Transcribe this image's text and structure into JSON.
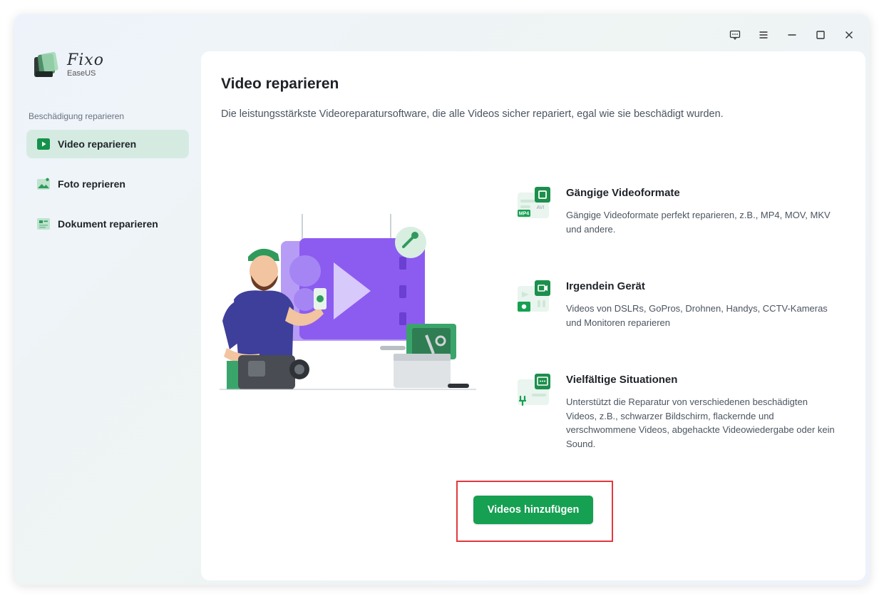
{
  "app": {
    "name": "Fixo",
    "vendor": "EaseUS"
  },
  "window_controls": {
    "feedback_icon": "message-icon",
    "menu_icon": "hamburger-menu-icon",
    "minimize_icon": "minimize-icon",
    "maximize_icon": "maximize-icon",
    "close_icon": "close-icon"
  },
  "sidebar": {
    "section_label": "Beschädigung reparieren",
    "items": [
      {
        "label": "Video reparieren",
        "icon": "video-play-icon",
        "active": true
      },
      {
        "label": "Foto reprieren",
        "icon": "photo-icon",
        "active": false
      },
      {
        "label": "Dokument reparieren",
        "icon": "document-icon",
        "active": false
      }
    ]
  },
  "main": {
    "title": "Video reparieren",
    "subtitle": "Die leistungsstärkste Videoreparatursoftware, die alle Videos sicher repariert, egal wie sie beschädigt wurden.",
    "features": [
      {
        "title": "Gängige Videoformate",
        "description": "Gängige Videoformate perfekt reparieren, z.B., MP4, MOV, MKV und andere.",
        "icon": "video-format-icon",
        "icon_tags": [
          "MP4",
          "AVI"
        ]
      },
      {
        "title": "Irgendein Gerät",
        "description": "Videos von DSLRs, GoPros, Drohnen, Handys, CCTV-Kameras und Monitoren reparieren",
        "icon": "device-camera-icon"
      },
      {
        "title": "Vielfältige Situationen",
        "description": "Unterstützt die Reparatur von verschiedenen beschädigten Videos, z.B., schwarzer Bildschirm, flackernde und verschwommene Videos, abgehackte Videowiedergabe oder kein Sound.",
        "icon": "situation-screen-icon"
      }
    ],
    "primary_button": "Videos hinzufügen"
  },
  "colors": {
    "accent_green": "#16a052",
    "active_nav_bg": "#d5ebe2",
    "highlight_red": "#e2393f",
    "illustration_purple": "#8c5cf0"
  }
}
